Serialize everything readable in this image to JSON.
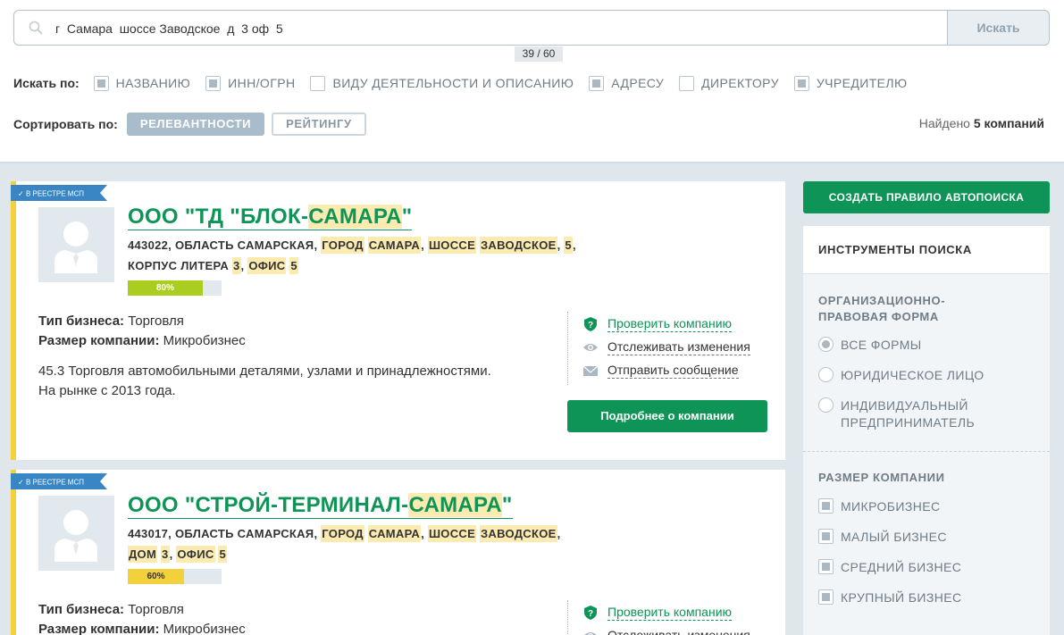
{
  "search": {
    "value": "г  Самара  шоссе Заводское  д  3 оф  5",
    "button": "Искать",
    "counter": "39 / 60"
  },
  "filters": {
    "title": "Искать по:",
    "items": [
      {
        "label": "НАЗВАНИЮ",
        "checked": true
      },
      {
        "label": "ИНН/ОГРН",
        "checked": true
      },
      {
        "label": "ВИДУ ДЕЯТЕЛЬНОСТИ И ОПИСАНИЮ",
        "checked": false
      },
      {
        "label": "АДРЕСУ",
        "checked": true
      },
      {
        "label": "ДИРЕКТОРУ",
        "checked": false
      },
      {
        "label": "УЧРЕДИТЕЛЮ",
        "checked": true
      }
    ]
  },
  "sort": {
    "title": "Сортировать по:",
    "options": [
      "РЕЛЕВАНТНОСТИ",
      "РЕЙТИНГУ"
    ]
  },
  "found": {
    "prefix": "Найдено",
    "count": "5 компаний"
  },
  "colors": {
    "green": "#0d9456",
    "yellow": "#f3d13a",
    "highlight": "#fcebb0"
  },
  "companies": [
    {
      "badge": "В РЕЕСТРЕ МСП",
      "name_prefix": "ООО \"ТД \"БЛОК-",
      "name_highlight": "САМАРА",
      "name_suffix": "\"",
      "addr": {
        "p1": "443022, ОБЛАСТЬ САМАРСКАЯ, ",
        "h1": "ГОРОД",
        "h2": "САМАРА",
        "p2": ", ",
        "h3": "ШОССЕ",
        "h4": "ЗАВОДСКОЕ",
        "p3": ", ",
        "h5": "5",
        "p4": ",",
        "line2_a": "КОРПУС ЛИТЕРА ",
        "h6": "3",
        "p5": ", ",
        "h7": "ОФИС",
        "h8": "5"
      },
      "rating": 0.8,
      "rating_label": "80%",
      "business_type_label": "Тип бизнеса:",
      "business_type": "Торговля",
      "size_label": "Размер компании:",
      "size": "Микробизнес",
      "activity": "45.3 Торговля автомобильными деталями, узлами и принадлежностями.",
      "since": "На рынке с 2013 года.",
      "actions": [
        "Проверить компанию",
        "Отслеживать изменения",
        "Отправить сообщение"
      ],
      "more": "Подробнее о компании"
    },
    {
      "badge": "В РЕЕСТРЕ МСП",
      "name_prefix": "ООО \"СТРОЙ-ТЕРМИНАЛ-",
      "name_highlight": "САМАРА",
      "name_suffix": "\"",
      "addr": {
        "p1": "443017, ОБЛАСТЬ САМАРСКАЯ, ",
        "h1": "ГОРОД",
        "h2": "САМАРА",
        "p2": ", ",
        "h3": "ШОССЕ",
        "h4": "ЗАВОДСКОЕ",
        "p3": ",",
        "h5": "ДОМ",
        "h6": "3",
        "p4": ", ",
        "h7": "ОФИС",
        "h8": "5"
      },
      "rating": 0.6,
      "rating_label": "60%",
      "business_type_label": "Тип бизнеса:",
      "business_type": "Торговля",
      "size_label": "Размер компании:",
      "size": "Микробизнес",
      "actions": [
        "Проверить компанию",
        "Отслеживать изменения"
      ]
    }
  ],
  "sidebar": {
    "auto_button": "СОЗДАТЬ ПРАВИЛО АВТОПОИСКА",
    "tools_title": "ИНСТРУМЕНТЫ ПОИСКА",
    "form_title_1": "ОРГАНИЗАЦИОННО-",
    "form_title_2": "ПРАВОВАЯ ФОРМА",
    "forms": [
      {
        "label": "ВСЕ ФОРМЫ",
        "selected": true
      },
      {
        "label": "ЮРИДИЧЕСКОЕ ЛИЦО",
        "selected": false
      },
      {
        "label_1": "ИНДИВИДУАЛЬНЫЙ",
        "label_2": "ПРЕДПРИНИМАТЕЛЬ",
        "selected": false
      }
    ],
    "size_title": "РАЗМЕР КОМПАНИИ",
    "sizes": [
      {
        "label": "МИКРОБИЗНЕС",
        "checked": true
      },
      {
        "label": "МАЛЫЙ БИЗНЕС",
        "checked": true
      },
      {
        "label": "СРЕДНИЙ БИЗНЕС",
        "checked": true
      },
      {
        "label": "КРУПНЫЙ БИЗНЕС",
        "checked": true
      }
    ]
  }
}
